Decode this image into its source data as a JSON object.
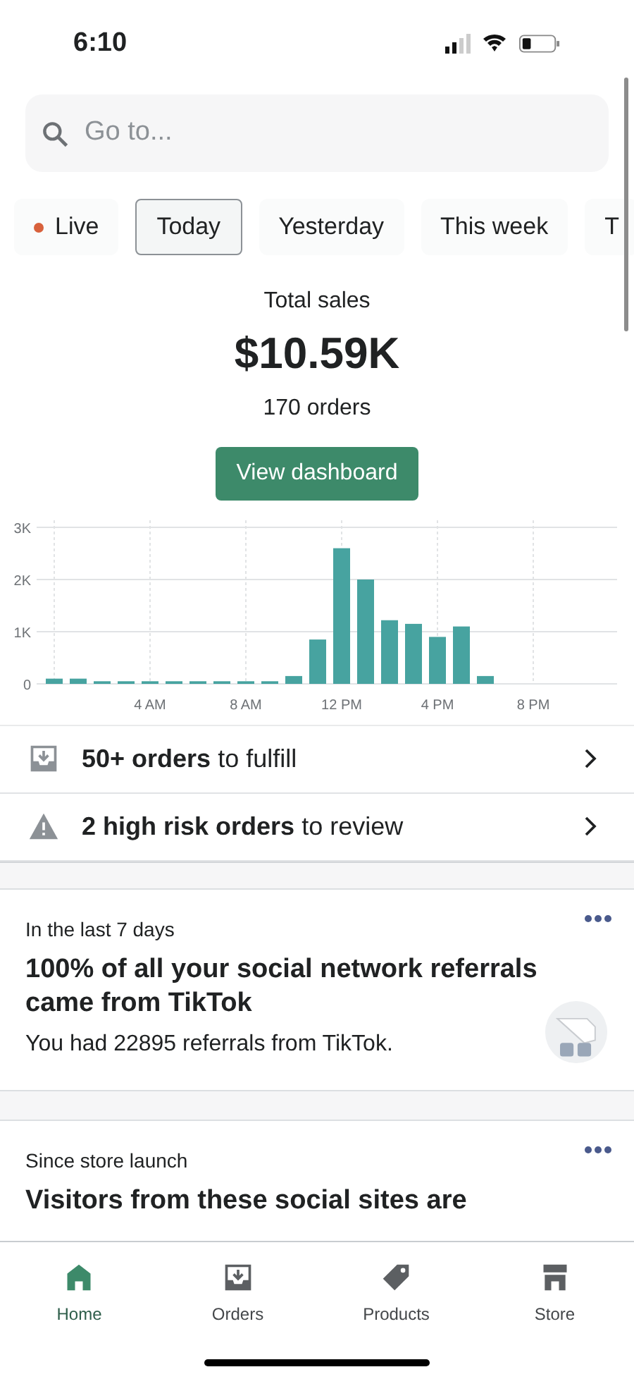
{
  "status_bar": {
    "time": "6:10"
  },
  "search": {
    "placeholder": "Go to..."
  },
  "tabs": [
    {
      "label": "Live",
      "kind": "live",
      "selected": false
    },
    {
      "label": "Today",
      "kind": "period",
      "selected": true
    },
    {
      "label": "Yesterday",
      "kind": "period",
      "selected": false
    },
    {
      "label": "This week",
      "kind": "period",
      "selected": false
    },
    {
      "label": "T",
      "kind": "period",
      "selected": false
    }
  ],
  "summary": {
    "title": "Total sales",
    "amount": "$10.59K",
    "orders": "170 orders",
    "button": "View dashboard"
  },
  "chart_data": {
    "type": "bar",
    "categories": [
      null,
      null,
      null,
      null,
      "4 AM",
      null,
      null,
      null,
      "8 AM",
      null,
      null,
      null,
      "12 PM",
      null,
      null,
      null,
      "4 PM",
      null,
      null,
      null,
      "8 PM",
      null,
      null,
      null
    ],
    "grid": true,
    "series": [
      {
        "color": "#47a3a0",
        "values": [
          100,
          100,
          50,
          50,
          50,
          50,
          50,
          50,
          50,
          50,
          150,
          850,
          2600,
          2000,
          1220,
          1150,
          900,
          1100,
          150,
          0,
          0,
          0,
          0,
          0
        ]
      }
    ],
    "ylim": [
      0,
      3000
    ],
    "yticks": [
      {
        "value": 0,
        "label": "0"
      },
      {
        "value": 1000,
        "label": "1K"
      },
      {
        "value": 2000,
        "label": "2K"
      },
      {
        "value": 3000,
        "label": "3K"
      }
    ],
    "orientation": "vertical"
  },
  "tasks": [
    {
      "kind": "inbox",
      "text": "**50+ orders** to fulfill"
    },
    {
      "kind": "warning",
      "text": "**2 high risk orders** to review"
    }
  ],
  "cards": [
    {
      "caption": "In the last 7 days",
      "title": "100% of all your social network referrals came from TikTok",
      "body": "You had 22895 referrals from TikTok.",
      "kind": "illustrated"
    },
    {
      "caption": "Since store launch",
      "title": "Visitors from these social sites are",
      "kind": "plain"
    }
  ],
  "nav": [
    {
      "label": "Home",
      "kind": "home",
      "selected": true
    },
    {
      "label": "Orders",
      "kind": "inbox",
      "selected": false
    },
    {
      "label": "Products",
      "kind": "tag",
      "selected": false
    },
    {
      "label": "Store",
      "kind": "store",
      "selected": false
    }
  ]
}
